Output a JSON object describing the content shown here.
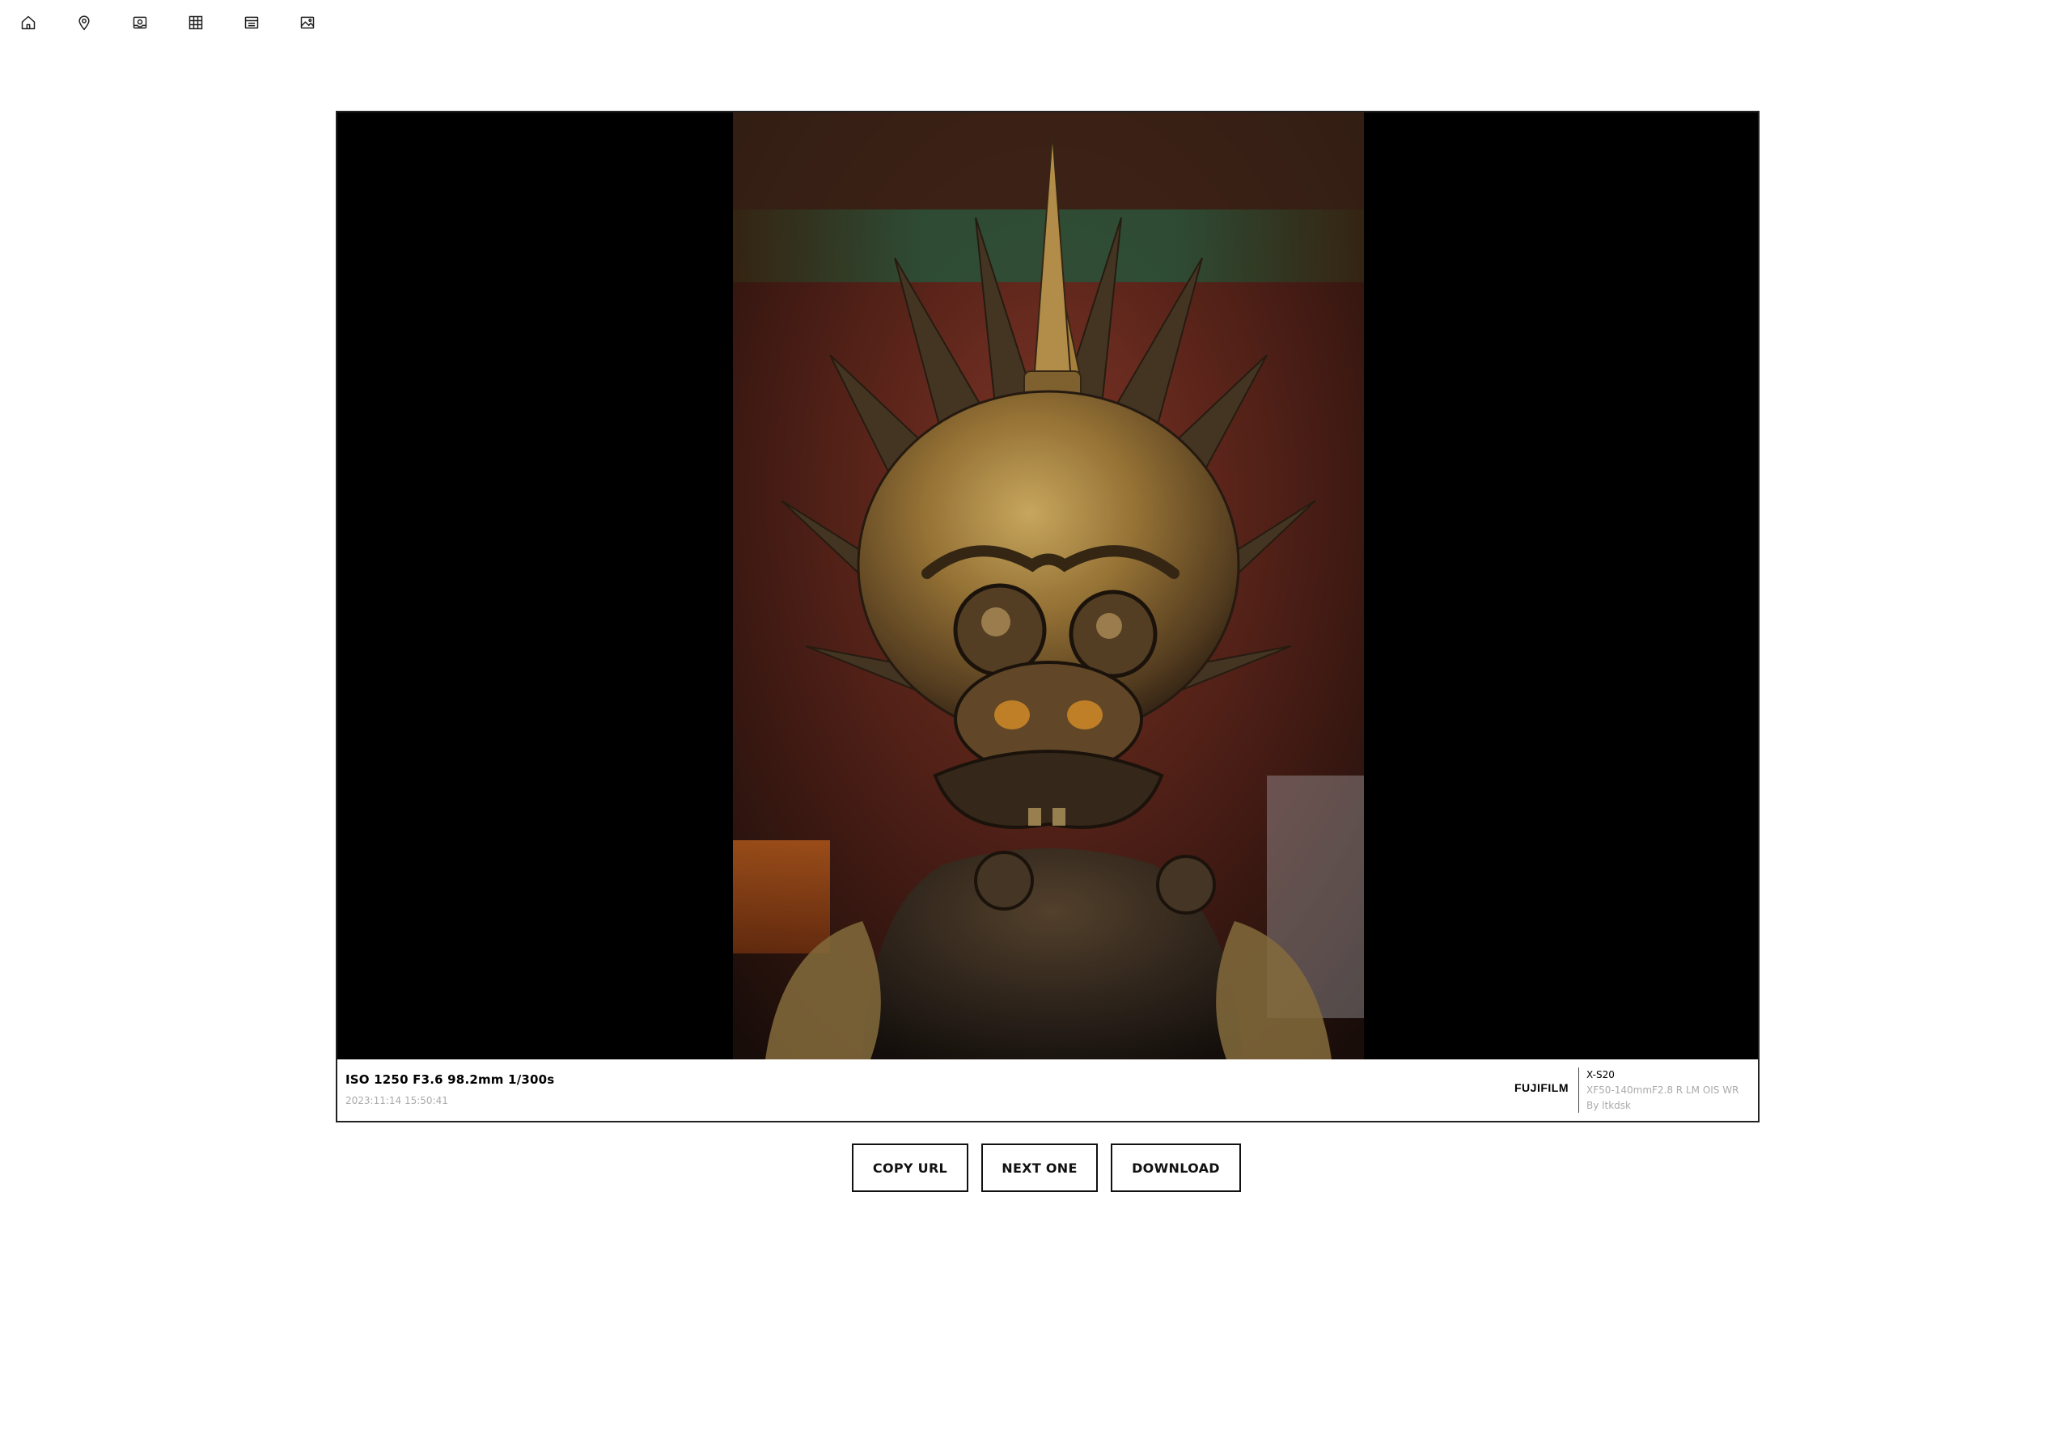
{
  "nav": {
    "items": [
      {
        "icon": "home-icon"
      },
      {
        "icon": "location-pin-icon"
      },
      {
        "icon": "album-icon"
      },
      {
        "icon": "grid-icon"
      },
      {
        "icon": "list-icon"
      },
      {
        "icon": "image-icon"
      }
    ]
  },
  "photo": {
    "exif": "ISO 1250 F3.6 98.2mm 1/300s",
    "datetime": "2023:11:14 15:50:41",
    "brand": "FUJIFILM",
    "camera": "X-S20",
    "lens": "XF50-140mmF2.8 R LM OIS WR",
    "author": "By ltkdsk"
  },
  "actions": {
    "copy_url": "COPY URL",
    "next_one": "NEXT ONE",
    "download": "DOWNLOAD"
  },
  "colors": {
    "background": "#ffffff",
    "stage": "#000000",
    "muted_text": "#aaaaaa",
    "border": "#222222"
  }
}
